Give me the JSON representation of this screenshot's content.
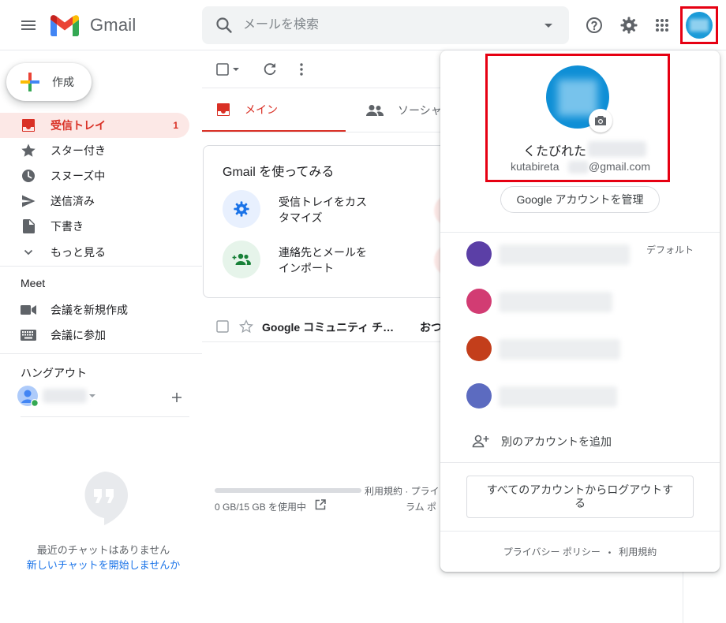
{
  "header": {
    "app_name": "Gmail",
    "search_placeholder": "メールを検索"
  },
  "sidebar": {
    "compose_label": "作成",
    "items": [
      {
        "label": "受信トレイ",
        "count": "1"
      },
      {
        "label": "スター付き"
      },
      {
        "label": "スヌーズ中"
      },
      {
        "label": "送信済み"
      },
      {
        "label": "下書き"
      },
      {
        "label": "もっと見る"
      }
    ],
    "meet": {
      "heading": "Meet",
      "new_meeting": "会議を新規作成",
      "join_meeting": "会議に参加"
    },
    "hangouts": {
      "heading": "ハングアウト",
      "no_chats": "最近のチャットはありません",
      "start_chat": "新しいチャットを開始しませんか"
    }
  },
  "main": {
    "tabs": [
      {
        "label": "メイン"
      },
      {
        "label": "ソーシャ"
      }
    ],
    "getting_started": {
      "title": "Gmail を使ってみる",
      "items": [
        {
          "line1": "受信トレイをカス",
          "line2": "タマイズ"
        },
        {
          "line1": "連絡先とメールを",
          "line2": "インポート"
        }
      ]
    },
    "email_row": {
      "sender": "Google コミュニティ チ…",
      "subject": "おつ"
    },
    "storage": {
      "usage": "0 GB/15 GB を使用中",
      "fraction": 0,
      "terms_line1": "利用規約 · プライ",
      "terms_line2": "ラム ポ"
    }
  },
  "account_popup": {
    "name": "くたびれた",
    "email_prefix": "kutabireta",
    "email_suffix": "@gmail.com",
    "manage_button": "Google アカウントを管理",
    "default_label": "デフォルト",
    "add_account": "別のアカウントを追加",
    "logout_button": "すべてのアカウントからログアウトする",
    "footer": {
      "privacy": "プライバシー ポリシー",
      "separator": "•",
      "terms": "利用規約"
    },
    "account_colors": [
      "#5b3fa6",
      "#d23c73",
      "#c33e1b",
      "#5c6bc0"
    ]
  },
  "colors": {
    "accent_red": "#d93025",
    "highlight_red": "#e60012",
    "avatar_blue": "#0f8fd6",
    "active_bg": "#fce8e6"
  }
}
